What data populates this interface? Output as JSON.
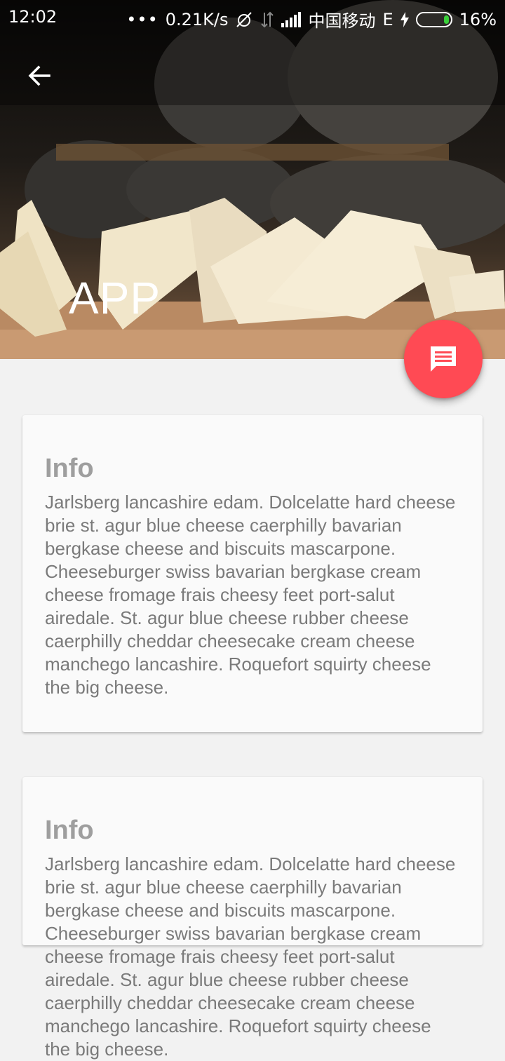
{
  "status_bar": {
    "time": "12:02",
    "dots": "•••",
    "net_speed": "0.21K/s",
    "carrier": "中国移动",
    "network_type": "E",
    "battery_percent": "16%",
    "battery_level": 0.16
  },
  "toolbar": {
    "title": "APP",
    "back_icon": "arrow-back-icon",
    "hero_image": "cheese-photo"
  },
  "fab": {
    "icon": "message-icon",
    "color": "#ff4a54"
  },
  "cards": [
    {
      "title": "Info",
      "body": "Jarlsberg lancashire edam. Dolcelatte hard cheese brie st. agur blue cheese caerphilly bavarian bergkase cheese and biscuits mascarpone. Cheeseburger swiss bavarian bergkase cream cheese fromage frais cheesy feet port-salut airedale. St. agur blue cheese rubber cheese caerphilly cheddar cheesecake cream cheese manchego lancashire. Roquefort squirty cheese the big cheese."
    },
    {
      "title": "Info",
      "body": "Jarlsberg lancashire edam. Dolcelatte hard cheese brie st. agur blue cheese caerphilly bavarian bergkase cheese and biscuits mascarpone. Cheeseburger swiss bavarian bergkase cream cheese fromage frais cheesy feet port-salut airedale. St. agur blue cheese rubber cheese caerphilly cheddar cheesecake cream cheese manchego lancashire. Roquefort squirty cheese the big cheese."
    }
  ]
}
